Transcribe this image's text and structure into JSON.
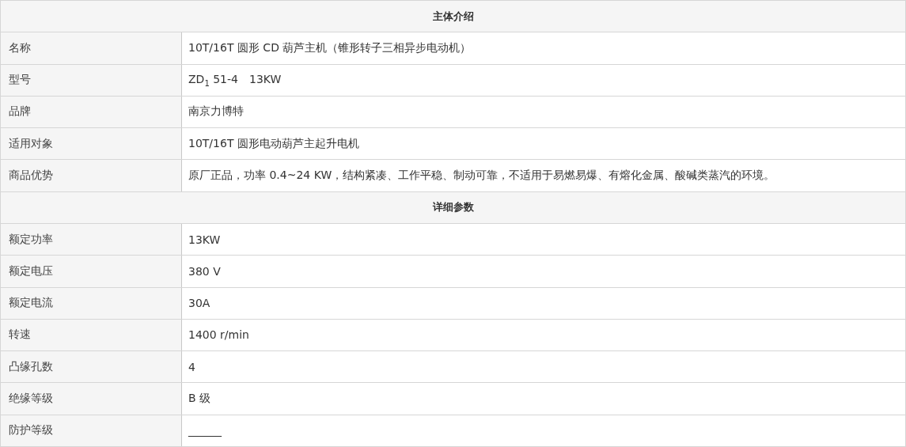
{
  "sections": [
    {
      "title": "主体介绍",
      "rows": [
        {
          "label": "名称",
          "value": "10T/16T 圆形 CD 葫芦主机（锥形转子三相异步电动机）"
        },
        {
          "label": "型号",
          "value": "ZD$_{1}$ 51-4　13KW"
        },
        {
          "label": "品牌",
          "value": "南京力博特"
        },
        {
          "label": "适用对象",
          "value": "10T/16T 圆形电动葫芦主起升电机"
        },
        {
          "label": "商品优势",
          "value": "原厂正品，功率 0.4~24 KW，结构紧凑、工作平稳、制动可靠，不适用于易燃易爆、有熔化金属、酸碱类蒸汽的环境。"
        }
      ]
    },
    {
      "title": "详细参数",
      "rows": [
        {
          "label": "额定功率",
          "value": "13KW"
        },
        {
          "label": "额定电压",
          "value": "380 V"
        },
        {
          "label": "额定电流",
          "value": "30A"
        },
        {
          "label": "转速",
          "value": "1400 r/min"
        },
        {
          "label": "凸缘孔数",
          "value": "4"
        },
        {
          "label": "绝缘等级",
          "value": "B 级"
        },
        {
          "label": "防护等级",
          "value": "______"
        }
      ]
    }
  ]
}
